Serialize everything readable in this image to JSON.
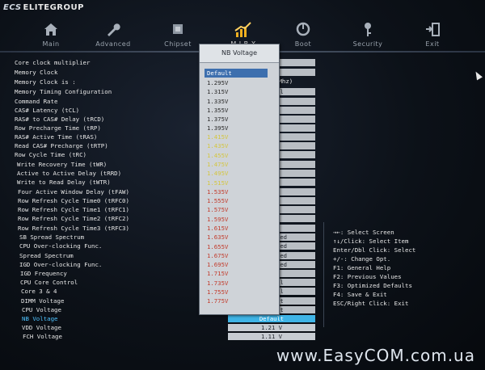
{
  "brand": {
    "ecs": "ECS",
    "name": "ELITEGROUP"
  },
  "nav": [
    {
      "label": "Main",
      "icon": "home-icon"
    },
    {
      "label": "Advanced",
      "icon": "wrench-icon"
    },
    {
      "label": "Chipset",
      "icon": "chip-icon"
    },
    {
      "label": "M.I.B X",
      "icon": "chart-icon",
      "active": true
    },
    {
      "label": "Boot",
      "icon": "power-icon"
    },
    {
      "label": "Security",
      "icon": "key-icon"
    },
    {
      "label": "Exit",
      "icon": "exit-icon"
    }
  ],
  "settings": [
    "Core clock multiplier",
    "Memory Clock",
    "Memory Clock is :",
    "Memory Timing Configuration",
    "Command Rate",
    "CAS# Latency (tCL)",
    "RAS# to CAS# Delay (tRCD)",
    "Row Precharge Time (tRP)",
    "RAS# Active Time (tRAS)",
    "Read CAS# Precharge (tRTP)",
    "Row Cycle Time (tRC)",
    "Write Recovery Time (tWR)",
    "Active to Active Delay (tRRD)",
    "Write to Read Delay (tWTR)",
    "Four Active Window Delay (tFAW)",
    "Row Refresh Cycle Time0 (tRFC0)",
    "Row Refresh Cycle Time1 (tRFC1)",
    "Row Refresh Cycle Time2 (tRFC2)",
    "Row Refresh Cycle Time3 (tRFC3)",
    "SB Spread Spectrum",
    "CPU Over-clocking Func.",
    "Spread Spectrum",
    "IGD Over-clocking Func.",
    "IGD Frequency",
    "CPU Core Control",
    "Core 3 & 4",
    "DIMM Voltage",
    "CPU Voltage",
    "NB Voltage",
    "VDD Voltage",
    "FCH Voltage"
  ],
  "highlighted_setting": "NB Voltage",
  "value_column": [
    "o",
    "o",
    "7Mhz)",
    "al",
    "o",
    "o",
    "o",
    "o",
    "o",
    "o",
    "o",
    "o",
    "o",
    "o",
    "o",
    "o",
    "o",
    "o",
    "o",
    "led",
    "led",
    "led",
    "led",
    "o",
    "al",
    "al",
    "lt",
    "lt",
    "Default",
    "1.21 V",
    "1.11 V"
  ],
  "popup": {
    "title": "NB Voltage",
    "options": [
      "Default",
      "1.295V",
      "1.315V",
      "1.335V",
      "1.355V",
      "1.375V",
      "1.395V",
      "1.415V",
      "1.435V",
      "1.455V",
      "1.475V",
      "1.495V",
      "1.515V",
      "1.535V",
      "1.555V",
      "1.575V",
      "1.595V",
      "1.615V",
      "1.635V",
      "1.655V",
      "1.675V",
      "1.695V",
      "1.715V",
      "1.735V",
      "1.755V",
      "1.775V"
    ]
  },
  "help": [
    "→←: Select Screen",
    "↑↓/Click: Select Item",
    "Enter/Dbl Click: Select",
    "+/-: Change Opt.",
    "F1: General Help",
    "F2: Previous Values",
    "F3: Optimized Defaults",
    "F4: Save & Exit",
    "ESC/Right Click: Exit"
  ],
  "watermark": "www.EasyCOM.com.ua",
  "colors": {
    "accent": "#3fb4e6",
    "popup_selected": "#3d6fae",
    "option_red": "#c23b2b",
    "option_yellow": "#d4c640"
  }
}
